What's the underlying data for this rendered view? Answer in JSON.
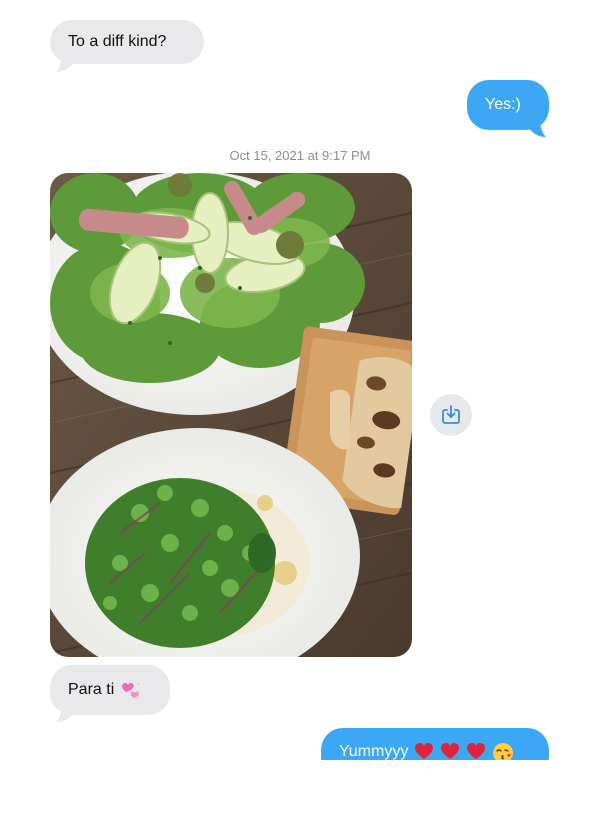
{
  "messages": [
    {
      "id": "m1",
      "direction": "incoming",
      "text": "To a diff kind?"
    },
    {
      "id": "m2",
      "direction": "outgoing",
      "text": "Yes:)"
    },
    {
      "id": "m3",
      "direction": "incoming",
      "text": "Para ti"
    },
    {
      "id": "m4",
      "direction": "outgoing",
      "text": "Yummyyy"
    }
  ],
  "timestamp": "Oct 15, 2021 at 9:17 PM",
  "icons": {
    "sparkling_hearts": "two-pink-hearts-emoji",
    "red_heart": "red-heart-emoji",
    "kiss_face": "face-blowing-kiss-emoji",
    "save": "download-to-photos-icon"
  },
  "colors": {
    "incoming_bubble": "#e9e9eb",
    "outgoing_bubble": "#3ca8f5",
    "timestamp_text": "#8e8e93"
  }
}
